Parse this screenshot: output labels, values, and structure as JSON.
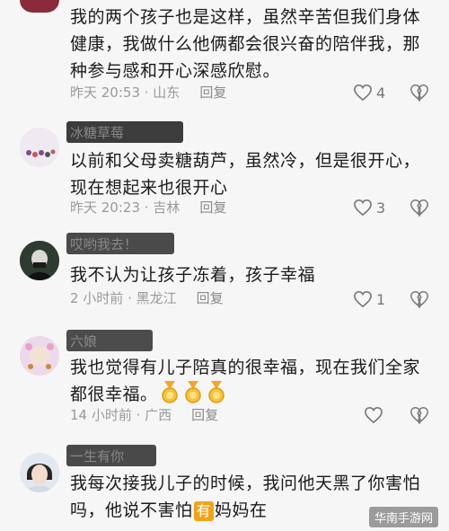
{
  "comments": [
    {
      "username": "",
      "text_lines": [
        "我的两个孩子也是这样，虽然辛苦但我们身体",
        "健康，我做什么他俩都会很兴奋的陪伴我，那",
        "种参与感和开心深感欣慰。"
      ],
      "time": "昨天 20:53 · 山东",
      "reply": "回复",
      "likes": "4"
    },
    {
      "username": "冰糖草莓",
      "text_lines": [
        "以前和父母卖糖葫芦，虽然冷，但是很开心，",
        "现在想起来也很开心"
      ],
      "time": "昨天 20:23 · 吉林",
      "reply": "回复",
      "likes": "3"
    },
    {
      "username": "哎哟我去！",
      "text_lines": [
        "我不认为让孩子冻着，孩子幸福"
      ],
      "time": "2 小时前 · 黑龙江",
      "reply": "回复",
      "likes": "1"
    },
    {
      "username": "六娘",
      "text_lines": [
        "我也觉得有儿子陪真的很幸福，现在我们全家",
        "都很幸福。"
      ],
      "time": "14 小时前 · 广西",
      "reply": "回复",
      "likes": ""
    },
    {
      "username": "一生有你",
      "text_lines": [
        "我每次接我儿子的时候，我问他天黑了你害怕",
        "吗，他说不害怕"
      ],
      "text_tail": "妈妈在",
      "badge": "有"
    }
  ],
  "watermark": "华南手游网",
  "colors": {
    "text": "#1a1a1a",
    "meta": "#9a9a9a",
    "badge": "#f0a31a"
  }
}
